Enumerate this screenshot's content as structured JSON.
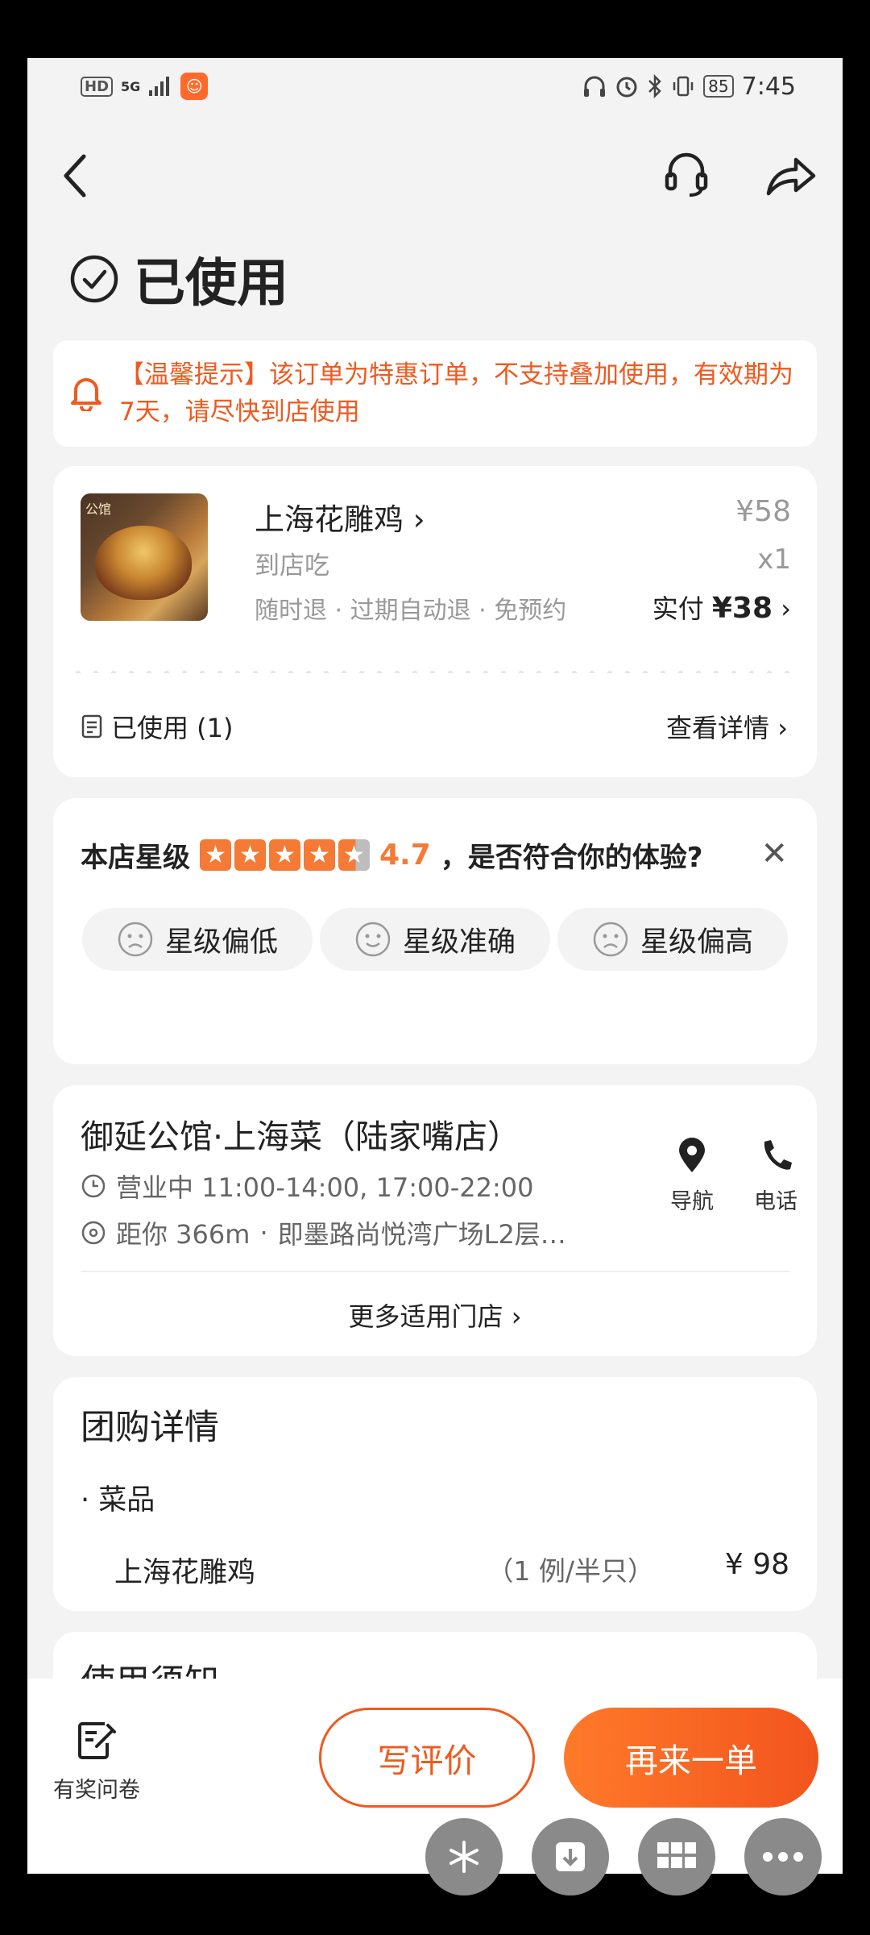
{
  "status_bar": {
    "time": "7:45",
    "battery": "85",
    "network": "5G",
    "hd": "HD"
  },
  "header": {
    "title": "已使用"
  },
  "notice": {
    "text": "【温馨提示】该订单为特惠订单，不支持叠加使用，有效期为7天，请尽快到店使用"
  },
  "order": {
    "thumb_badge": "公馆",
    "dish_name": "上海花雕鸡",
    "dish_sub": "到店吃",
    "tags": "随时退 · 过期自动退 · 免预约",
    "price": "¥58",
    "quantity": "x1",
    "paid_label": "实付",
    "paid_value": "¥38",
    "used_label": "已使用 (1)",
    "detail_link": "查看详情"
  },
  "rating": {
    "prefix": "本店星级",
    "score": "4.7",
    "question": "，是否符合你的体验?",
    "stars": 4.7,
    "options": [
      "星级偏低",
      "星级准确",
      "星级偏高"
    ]
  },
  "store": {
    "name": "御延公馆·上海菜（陆家嘴店）",
    "hours": "营业中 11:00-14:00, 17:00-22:00",
    "distance": "距你 366m",
    "address": "即墨路尚悦湾广场L2层…",
    "nav_label": "导航",
    "phone_label": "电话",
    "more_stores": "更多适用门店"
  },
  "group_detail": {
    "title": "团购详情",
    "category": "菜品",
    "item_name": "上海花雕鸡",
    "item_spec": "（1 例/半只）",
    "item_price": "¥ 98"
  },
  "usage": {
    "title": "使用须知"
  },
  "bottom": {
    "survey_label": "有奖问卷",
    "review_button": "写评价",
    "reorder_button": "再来一单"
  },
  "colors": {
    "accent": "#ef5a1f",
    "star": "#f47a35",
    "background": "#f3f3f3"
  }
}
